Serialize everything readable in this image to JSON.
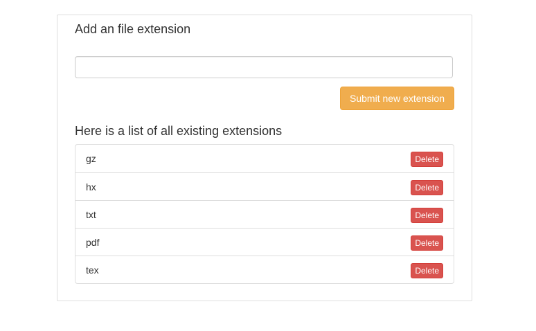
{
  "add_section": {
    "heading": "Add an file extension",
    "input_value": "",
    "input_placeholder": "",
    "submit_label": "Submit new extension"
  },
  "list_section": {
    "heading": "Here is a list of all existing extensions",
    "delete_label": "Delete",
    "extensions": [
      "gz",
      "hx",
      "txt",
      "pdf",
      "tex"
    ]
  },
  "colors": {
    "submit_button": "#f0ad4e",
    "delete_button": "#d9534f"
  }
}
